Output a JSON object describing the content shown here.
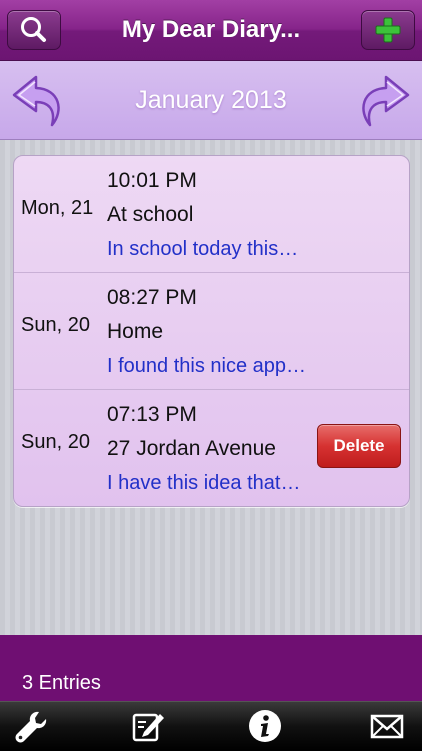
{
  "header": {
    "title": "My Dear Diary...",
    "search_icon": "search-icon",
    "add_icon": "plus-icon"
  },
  "month_bar": {
    "label": "January 2013",
    "prev_icon": "curved-arrow-left-icon",
    "next_icon": "curved-arrow-right-icon"
  },
  "entries": [
    {
      "date": "Mon, 21",
      "time": "10:01 PM",
      "title": "At school",
      "snippet": "In school today this…"
    },
    {
      "date": "Sun, 20",
      "time": "08:27 PM",
      "title": "Home",
      "snippet": "I found this nice app…"
    },
    {
      "date": "Sun, 20",
      "time": "07:13 PM",
      "title": "27 Jordan Avenue",
      "snippet": "I have this idea that…",
      "delete_label": "Delete"
    }
  ],
  "footer": {
    "count_label": "3 Entries"
  },
  "toolbar": {
    "icons": [
      "wrench-icon",
      "edit-icon",
      "info-icon",
      "mail-icon"
    ]
  },
  "colors": {
    "header": "#86248a",
    "month_bar": "#d0b5ee",
    "footer": "#6f0f72",
    "snippet_text": "#2230c8",
    "delete": "#d63231"
  }
}
